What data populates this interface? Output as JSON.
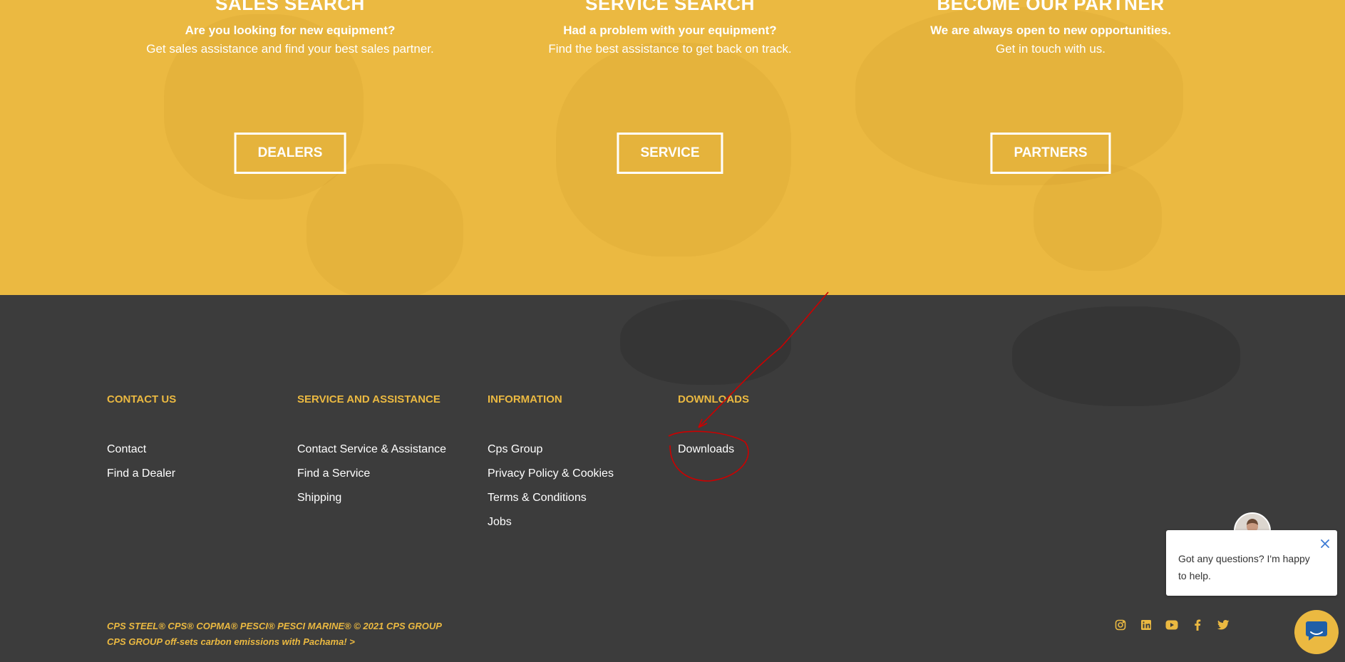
{
  "hero": {
    "columns": [
      {
        "title": "SALES SEARCH",
        "subtitle": "Are you looking for new equipment?",
        "description": "Get sales assistance and find your best sales partner.",
        "button": "DEALERS"
      },
      {
        "title": "SERVICE SEARCH",
        "subtitle": "Had a problem with your equipment?",
        "description": "Find the best assistance to get back on track.",
        "button": "SERVICE"
      },
      {
        "title": "BECOME OUR PARTNER",
        "subtitle": "We are always open to new opportunities.",
        "description": "Get in touch with us.",
        "button": "PARTNERS"
      }
    ]
  },
  "footer": {
    "columns": [
      {
        "heading": "CONTACT US",
        "links": [
          "Contact",
          "Find a Dealer"
        ]
      },
      {
        "heading": "SERVICE AND ASSISTANCE",
        "links": [
          "Contact Service & Assistance",
          "Find a Service",
          "Shipping"
        ]
      },
      {
        "heading": "INFORMATION",
        "links": [
          "Cps Group",
          "Privacy Policy & Cookies",
          "Terms & Conditions",
          "Jobs"
        ]
      },
      {
        "heading": "DOWNLOADS",
        "links": [
          "Downloads"
        ]
      }
    ],
    "copyright_line1": "CPS STEEL® CPS® COPMA® PESCI® PESCI MARINE® © 2021 CPS GROUP",
    "copyright_line2": "CPS GROUP off-sets carbon emissions with Pachama! >",
    "social_icons": [
      "instagram-icon",
      "linkedin-icon",
      "youtube-icon",
      "facebook-icon",
      "twitter-icon"
    ]
  },
  "chat": {
    "message": "Got any questions? I'm happy to help.",
    "launcher_icon": "chat-icon"
  },
  "colors": {
    "accent": "#ebb941",
    "footer_bg": "#3c3c3c",
    "annotation": "#cc0000"
  }
}
